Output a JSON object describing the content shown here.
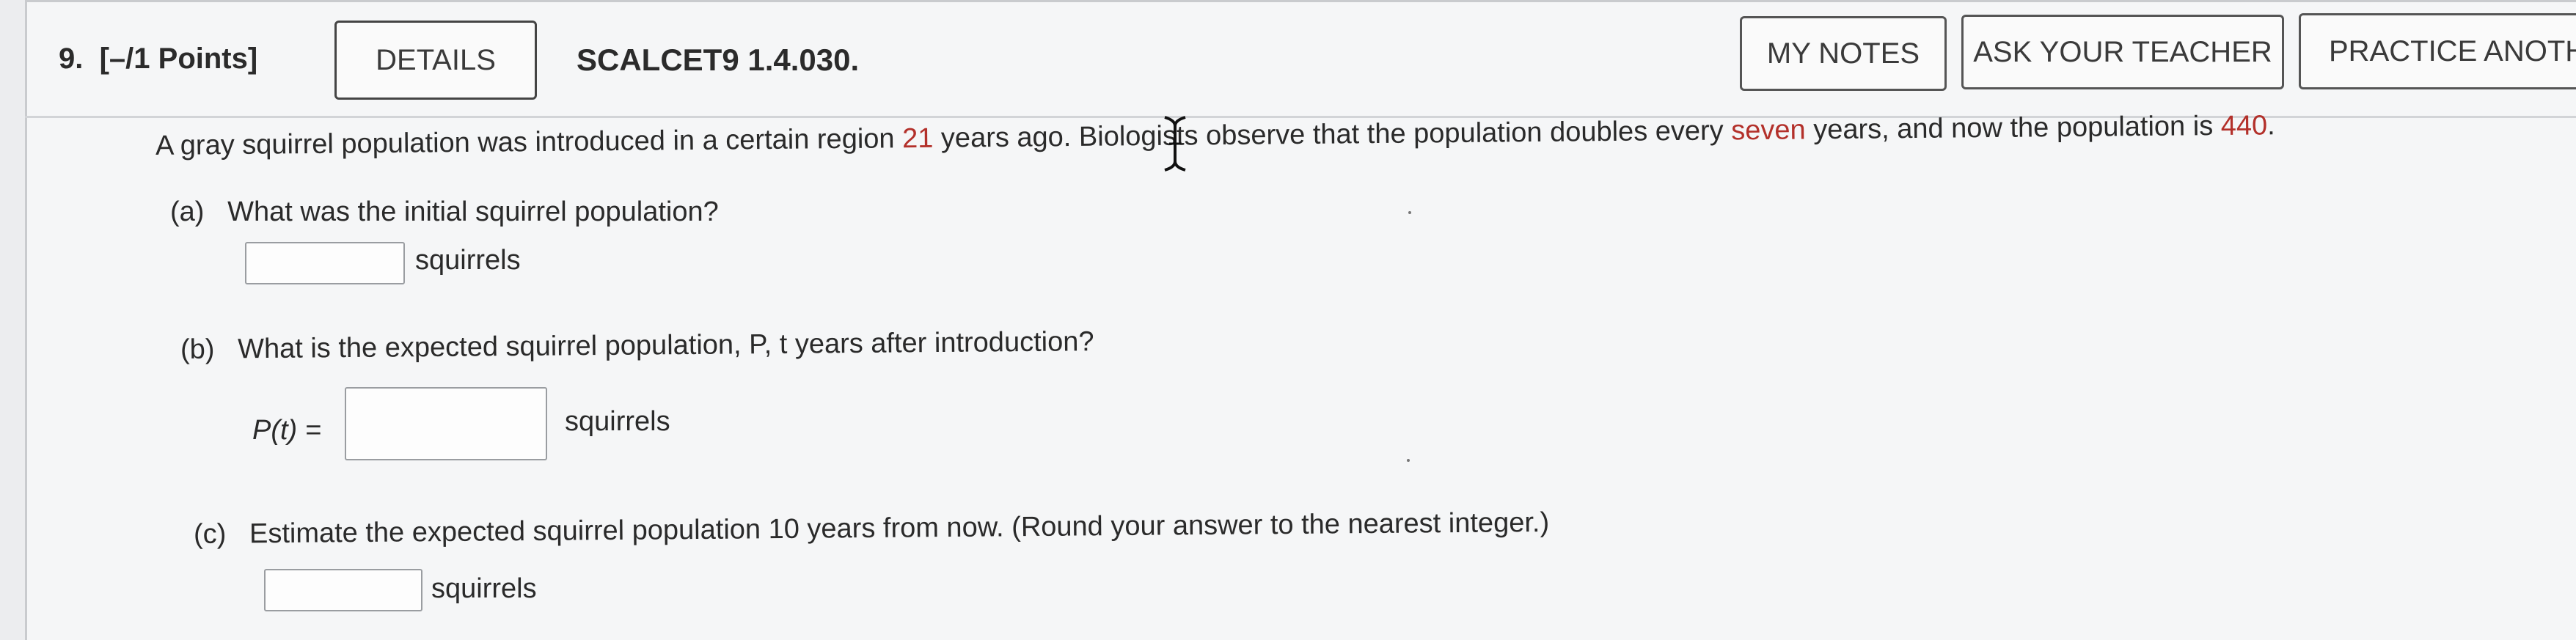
{
  "header": {
    "question_number": "9.",
    "points": "[–/1 Points]",
    "details_label": "DETAILS",
    "course_code": "SCALCET9 1.4.030.",
    "my_notes_label": "MY NOTES",
    "ask_teacher_label": "ASK YOUR TEACHER",
    "practice_label": "PRACTICE ANOTHER"
  },
  "problem": {
    "text_1": "A gray squirrel population was introduced in a certain region ",
    "years_ago_value": "21",
    "text_2": " years ago. Biologists observe that the population doubles every ",
    "doubling_period": "seven",
    "text_3": " years, and now the population is ",
    "current_population": "440",
    "text_4": "."
  },
  "parts": {
    "a": {
      "label": "(a)",
      "question": "What was the initial squirrel population?",
      "unit": "squirrels",
      "answer_value": ""
    },
    "b": {
      "label": "(b)",
      "question": "What is the expected squirrel population, P, t years after introduction?",
      "function_label": "P(t) =",
      "unit": "squirrels",
      "answer_value": ""
    },
    "c": {
      "label": "(c)",
      "question": "Estimate the expected squirrel population 10 years from now. (Round your answer to the nearest integer.)",
      "unit": "squirrels",
      "answer_value": ""
    }
  },
  "colors": {
    "highlight_red": "#b3302a",
    "card_background": "#f5f6f7",
    "button_border": "#555555"
  },
  "icons": {
    "text_cursor": "i-beam-cursor-icon"
  }
}
